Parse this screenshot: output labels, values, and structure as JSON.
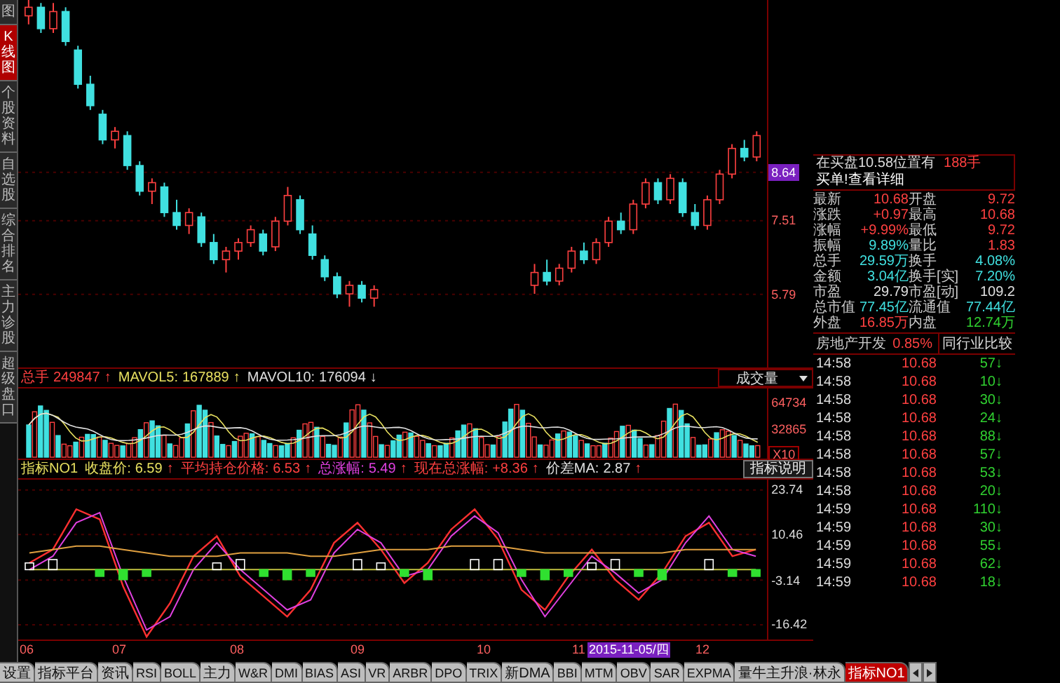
{
  "sidebar": {
    "items": [
      {
        "label": "图",
        "selected": false
      },
      {
        "label": "K线图",
        "selected": true
      },
      {
        "label": "个股资料",
        "selected": false
      },
      {
        "label": "自选股",
        "selected": false
      },
      {
        "label": "综合排名",
        "selected": false
      },
      {
        "label": "主力诊股",
        "selected": false
      },
      {
        "label": "超级盘口",
        "selected": false
      }
    ]
  },
  "price_chart": {
    "axis_marks": [
      {
        "highlighted": true
      },
      {
        "highlighted": false
      },
      {
        "highlighted": false
      }
    ],
    "chart_data": {
      "type": "candlestick",
      "grid": true,
      "ylim": [
        4.08,
        12.67
      ],
      "yticks": [
        {
          "value": 8.64,
          "label": "8.64"
        },
        {
          "value": 7.51,
          "label": "7.51"
        },
        {
          "value": 5.79,
          "label": "5.79"
        }
      ],
      "categories": [
        null,
        null,
        null,
        null,
        null,
        null,
        null,
        null,
        null,
        null,
        null,
        null,
        null,
        null,
        null,
        null,
        null,
        null,
        null,
        null,
        null,
        null,
        null,
        null,
        null,
        null,
        null,
        null,
        null,
        null,
        null,
        null,
        null,
        null,
        null,
        null,
        null,
        null,
        null,
        null,
        null,
        null,
        null,
        null,
        null,
        null,
        null,
        null,
        null,
        null,
        null,
        null,
        null,
        null,
        null,
        null,
        null,
        null,
        null,
        null
      ],
      "ohlc": [
        [
          12.3,
          12.7,
          12.1,
          12.5
        ],
        [
          12.5,
          12.6,
          11.9,
          12.0
        ],
        [
          12.0,
          12.6,
          11.9,
          12.4
        ],
        [
          12.4,
          12.5,
          11.6,
          11.7
        ],
        [
          11.5,
          11.6,
          10.6,
          10.7
        ],
        [
          10.7,
          10.9,
          10.1,
          10.2
        ],
        [
          10.0,
          10.1,
          9.3,
          9.4
        ],
        [
          9.4,
          9.7,
          9.2,
          9.6
        ],
        [
          9.5,
          9.6,
          8.7,
          8.8
        ],
        [
          8.8,
          8.9,
          8.1,
          8.2
        ],
        [
          8.2,
          8.5,
          7.9,
          8.4
        ],
        [
          8.3,
          8.4,
          7.6,
          7.7
        ],
        [
          7.7,
          8.0,
          7.3,
          7.4
        ],
        [
          7.4,
          7.8,
          7.2,
          7.7
        ],
        [
          7.6,
          7.7,
          6.9,
          7.0
        ],
        [
          7.0,
          7.2,
          6.5,
          6.6
        ],
        [
          6.6,
          6.9,
          6.3,
          6.8
        ],
        [
          6.8,
          7.1,
          6.6,
          7.0
        ],
        [
          7.0,
          7.4,
          6.9,
          7.3
        ],
        [
          7.2,
          7.3,
          6.7,
          6.8
        ],
        [
          6.9,
          7.6,
          6.8,
          7.5
        ],
        [
          7.5,
          8.3,
          7.4,
          8.1
        ],
        [
          8.0,
          8.1,
          7.2,
          7.3
        ],
        [
          7.2,
          7.4,
          6.6,
          6.7
        ],
        [
          6.6,
          6.7,
          6.1,
          6.2
        ],
        [
          6.2,
          6.3,
          5.7,
          5.8
        ],
        [
          5.8,
          6.1,
          5.5,
          6.0
        ],
        [
          6.0,
          6.1,
          5.6,
          5.7
        ],
        [
          5.7,
          6.0,
          5.5,
          5.9
        ],
        null,
        null,
        null,
        null,
        null,
        null,
        null,
        null,
        null,
        null,
        null,
        null,
        [
          6.0,
          6.5,
          5.8,
          6.3
        ],
        [
          6.3,
          6.6,
          6.0,
          6.1
        ],
        [
          6.1,
          6.5,
          6.0,
          6.4
        ],
        [
          6.4,
          6.9,
          6.3,
          6.8
        ],
        [
          6.8,
          7.0,
          6.5,
          6.6
        ],
        [
          6.6,
          7.1,
          6.5,
          7.0
        ],
        [
          7.0,
          7.6,
          6.9,
          7.5
        ],
        [
          7.5,
          7.7,
          7.2,
          7.3
        ],
        [
          7.3,
          8.0,
          7.2,
          7.9
        ],
        [
          7.9,
          8.5,
          7.8,
          8.4
        ],
        [
          8.4,
          8.5,
          7.9,
          8.0
        ],
        [
          8.0,
          8.6,
          7.9,
          8.5
        ],
        [
          8.4,
          8.5,
          7.6,
          7.7
        ],
        [
          7.7,
          7.9,
          7.3,
          7.4
        ],
        [
          7.4,
          8.1,
          7.3,
          8.0
        ],
        [
          8.0,
          8.7,
          7.9,
          8.6
        ],
        [
          8.6,
          9.3,
          8.5,
          9.2
        ],
        [
          9.2,
          9.4,
          8.9,
          9.0
        ],
        [
          9.0,
          9.6,
          8.9,
          9.5
        ]
      ]
    }
  },
  "volume_panel": {
    "stats": [
      {
        "label": "总手",
        "value": "249847",
        "trend": "↑",
        "color": "#ff4040"
      },
      {
        "label": "MAVOL5:",
        "value": "167889",
        "trend": "↑",
        "color": "#e8e060"
      },
      {
        "label": "MAVOL10:",
        "value": "176094",
        "trend": "↓",
        "color": "#e0e0e0"
      }
    ],
    "selector": "成交量",
    "axis": [
      "64734",
      "32865",
      "X10"
    ]
  },
  "indicator_panel": {
    "name": "指标NO1",
    "stats": [
      {
        "label": "收盘价:",
        "value": "6.59",
        "trend": "↑",
        "color": "#e8e060"
      },
      {
        "label": "平均持仓价格:",
        "value": "6.53",
        "trend": "↑",
        "color": "#ff4040"
      },
      {
        "label": "总涨幅:",
        "value": "5.49",
        "trend": "↑",
        "color": "#e040e0"
      },
      {
        "label": "现在总涨幅:",
        "value": "+8.36",
        "trend": "↑",
        "color": "#ff4040"
      },
      {
        "label": "价差MA:",
        "value": "2.87",
        "trend": "↑",
        "color": "#e0e0e0"
      }
    ],
    "help_button": "指标说明",
    "chart_data": {
      "type": "line",
      "grid": true,
      "ylim": [
        -20,
        26
      ],
      "yticks": [
        {
          "value": 23.74,
          "label": "23.74"
        },
        {
          "value": 10.46,
          "label": "10.46"
        },
        {
          "value": -3.14,
          "label": "-3.14"
        },
        {
          "value": -16.42,
          "label": "-16.42"
        }
      ],
      "series": [
        {
          "color": "#ff3030",
          "values": [
            2,
            6,
            18,
            15,
            -5,
            -20,
            -10,
            4,
            10,
            -2,
            -8,
            -14,
            -6,
            8,
            14,
            6,
            -4,
            2,
            12,
            18,
            9,
            -6,
            -12,
            -2,
            6,
            -3,
            -9,
            -1,
            10,
            14,
            4,
            6
          ]
        },
        {
          "color": "#e040e0",
          "values": [
            0,
            4,
            14,
            17,
            -2,
            -18,
            -14,
            0,
            8,
            0,
            -6,
            -12,
            -9,
            5,
            12,
            8,
            -2,
            0,
            10,
            16,
            11,
            -3,
            -14,
            -5,
            4,
            -1,
            -7,
            -3,
            8,
            16,
            6,
            4
          ]
        },
        {
          "color": "#e0a040",
          "values": [
            5,
            6,
            7,
            7,
            6,
            5,
            4,
            4,
            4,
            5,
            5,
            5,
            4,
            4,
            5,
            6,
            6,
            6,
            7,
            7,
            7,
            6,
            5,
            5,
            5,
            5,
            5,
            5,
            6,
            6,
            6,
            6
          ]
        },
        {
          "color": "#c0c040",
          "values": [
            0,
            0,
            0,
            0,
            0,
            0,
            0,
            0,
            0,
            0,
            0,
            0,
            0,
            0,
            0,
            0,
            0,
            0,
            0,
            0,
            0,
            0,
            0,
            0,
            0,
            0,
            0,
            0,
            0,
            0,
            0,
            0
          ]
        },
        {
          "type": "bar",
          "color": "#ffffff",
          "values": [
            2,
            3,
            null,
            null,
            null,
            null,
            null,
            null,
            2,
            3,
            null,
            null,
            null,
            null,
            3,
            2,
            null,
            null,
            null,
            3,
            3,
            null,
            null,
            null,
            2,
            3,
            null,
            null,
            null,
            3,
            null,
            null
          ]
        },
        {
          "type": "bar",
          "color": "#30e030",
          "values": [
            null,
            null,
            null,
            -2,
            -3,
            -2,
            null,
            null,
            null,
            null,
            -2,
            -3,
            -2,
            null,
            null,
            null,
            -2,
            -3,
            null,
            null,
            null,
            -2,
            -3,
            -2,
            null,
            null,
            -2,
            -3,
            null,
            null,
            -2,
            -2
          ]
        }
      ]
    }
  },
  "x_axis": [
    {
      "label": "06",
      "highlighted": false
    },
    {
      "label": "07",
      "highlighted": false
    },
    {
      "label": "08",
      "highlighted": false
    },
    {
      "label": "09",
      "highlighted": false
    },
    {
      "label": "10",
      "highlighted": false
    },
    {
      "label": "11",
      "highlighted": false
    },
    {
      "label": "2015-11-05/四",
      "highlighted": true
    },
    {
      "label": "12",
      "highlighted": false
    }
  ],
  "quote": {
    "notice": "在买盘10.58位置有",
    "notice_volume": "188手",
    "notice_link": "买单!查看详细",
    "fields": [
      {
        "label": "最新",
        "value": "10.68",
        "color": "#ff4040"
      },
      {
        "label": "开盘",
        "value": "9.72",
        "color": "#ff4040"
      },
      {
        "label": "涨跌",
        "value": "+0.97",
        "color": "#ff4040"
      },
      {
        "label": "最高",
        "value": "10.68",
        "color": "#ff4040"
      },
      {
        "label": "涨幅",
        "value": "+9.99%",
        "color": "#ff4040"
      },
      {
        "label": "最低",
        "value": "9.72",
        "color": "#ff4040"
      },
      {
        "label": "振幅",
        "value": "9.89%",
        "color": "#40e0e0"
      },
      {
        "label": "量比",
        "value": "1.83",
        "color": "#ff4040"
      },
      {
        "label": "总手",
        "value": "29.59万",
        "color": "#40e0e0"
      },
      {
        "label": "换手",
        "value": "4.08%",
        "color": "#40e0e0"
      },
      {
        "label": "金额",
        "value": "3.04亿",
        "color": "#40e0e0"
      },
      {
        "label": "换手[实]",
        "value": "7.20%",
        "color": "#40e0e0"
      },
      {
        "label": "市盈",
        "value": "29.79",
        "color": "#e0e0e0"
      },
      {
        "label": "市盈[动]",
        "value": "109.2",
        "color": "#e0e0e0"
      },
      {
        "label": "总市值",
        "value": "77.45亿",
        "color": "#40e0e0"
      },
      {
        "label": "流通值",
        "value": "77.44亿",
        "color": "#40e0e0"
      },
      {
        "label": "外盘",
        "value": "16.85万",
        "color": "#ff4040"
      },
      {
        "label": "内盘",
        "value": "12.74万",
        "color": "#30d030"
      }
    ]
  },
  "industry": {
    "name": "房地产开发",
    "change": "0.85%",
    "button": "同行业比较"
  },
  "ticks": [
    {
      "time": "14:58",
      "price": "10.68",
      "volume": "57",
      "direction": "↓"
    },
    {
      "time": "14:58",
      "price": "10.68",
      "volume": "10",
      "direction": "↓"
    },
    {
      "time": "14:58",
      "price": "10.68",
      "volume": "30",
      "direction": "↓"
    },
    {
      "time": "14:58",
      "price": "10.68",
      "volume": "24",
      "direction": "↓"
    },
    {
      "time": "14:58",
      "price": "10.68",
      "volume": "88",
      "direction": "↓"
    },
    {
      "time": "14:58",
      "price": "10.68",
      "volume": "57",
      "direction": "↓"
    },
    {
      "time": "14:58",
      "price": "10.68",
      "volume": "53",
      "direction": "↓"
    },
    {
      "time": "14:58",
      "price": "10.68",
      "volume": "20",
      "direction": "↓"
    },
    {
      "time": "14:59",
      "price": "10.68",
      "volume": "110",
      "direction": "↓"
    },
    {
      "time": "14:59",
      "price": "10.68",
      "volume": "30",
      "direction": "↓"
    },
    {
      "time": "14:59",
      "price": "10.68",
      "volume": "55",
      "direction": "↓"
    },
    {
      "time": "14:59",
      "price": "10.68",
      "volume": "62",
      "direction": "↓"
    },
    {
      "time": "14:59",
      "price": "10.68",
      "volume": "18",
      "direction": "↓"
    }
  ],
  "tabs": [
    {
      "label": "设置",
      "selected": false
    },
    {
      "label": "指标平台",
      "selected": false
    },
    {
      "label": "资讯",
      "selected": false
    },
    {
      "label": "RSI",
      "selected": false
    },
    {
      "label": "BOLL",
      "selected": false
    },
    {
      "label": "主力",
      "selected": false
    },
    {
      "label": "W&R",
      "selected": false
    },
    {
      "label": "DMI",
      "selected": false
    },
    {
      "label": "BIAS",
      "selected": false
    },
    {
      "label": "ASI",
      "selected": false
    },
    {
      "label": "VR",
      "selected": false
    },
    {
      "label": "ARBR",
      "selected": false
    },
    {
      "label": "DPO",
      "selected": false
    },
    {
      "label": "TRIX",
      "selected": false
    },
    {
      "label": "新DMA",
      "selected": false
    },
    {
      "label": "BBI",
      "selected": false
    },
    {
      "label": "MTM",
      "selected": false
    },
    {
      "label": "OBV",
      "selected": false
    },
    {
      "label": "SAR",
      "selected": false
    },
    {
      "label": "EXPMA",
      "selected": false
    },
    {
      "label": "量牛主升浪·林永",
      "selected": false
    },
    {
      "label": "指标NO1",
      "selected": true
    }
  ]
}
